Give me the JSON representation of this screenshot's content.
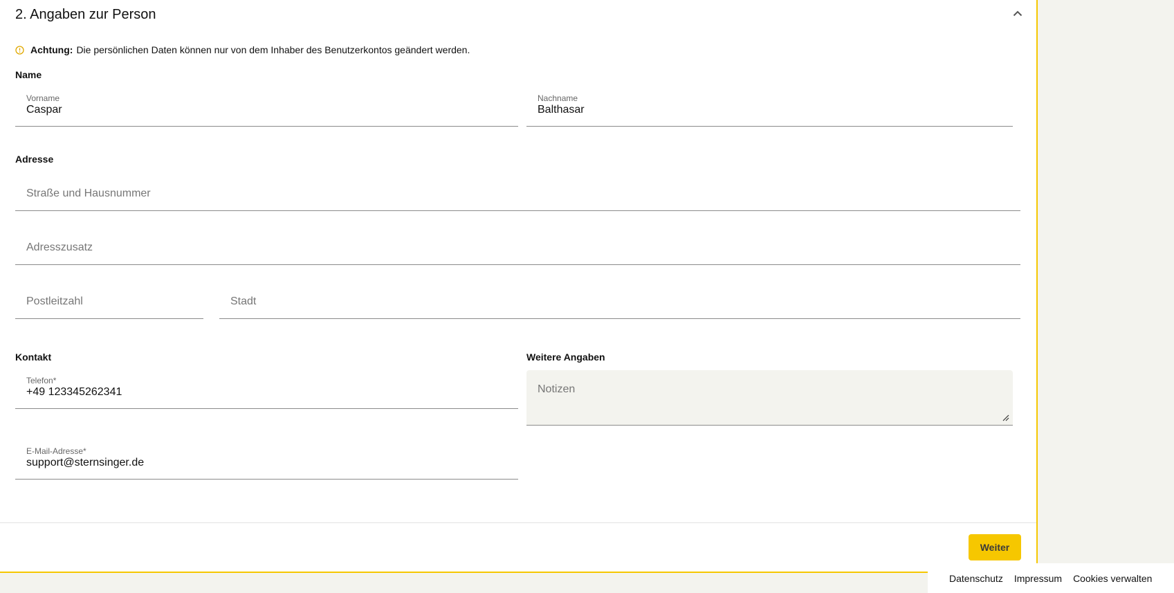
{
  "section": {
    "title": "2. Angaben zur Person",
    "notice_strong": "Achtung:",
    "notice_text": "Die persönlichen Daten können nur von dem Inhaber des Benutzerkontos geändert werden."
  },
  "name": {
    "heading": "Name",
    "first_label": "Vorname",
    "first_value": "Caspar",
    "last_label": "Nachname",
    "last_value": "Balthasar"
  },
  "address": {
    "heading": "Adresse",
    "street_placeholder": "Straße und Hausnummer",
    "extra_placeholder": "Adresszusatz",
    "zip_placeholder": "Postleitzahl",
    "city_placeholder": "Stadt"
  },
  "contact": {
    "heading": "Kontakt",
    "phone_label": "Telefon*",
    "phone_value": "+49 123345262341",
    "email_label": "E-Mail-Adresse*",
    "email_value": "support@sternsinger.de"
  },
  "further": {
    "heading": "Weitere Angaben",
    "notes_placeholder": "Notizen"
  },
  "actions": {
    "next_label": "Weiter"
  },
  "footer": {
    "links": [
      "Datenschutz",
      "Impressum",
      "Cookies verwalten"
    ]
  },
  "colors": {
    "accent": "#f6c700",
    "background": "#f3f3ee",
    "card": "#ffffff"
  },
  "icons": {
    "collapse": "chevron-up-icon",
    "notice": "warning-circle-icon",
    "resize": "resize-handle-icon"
  }
}
